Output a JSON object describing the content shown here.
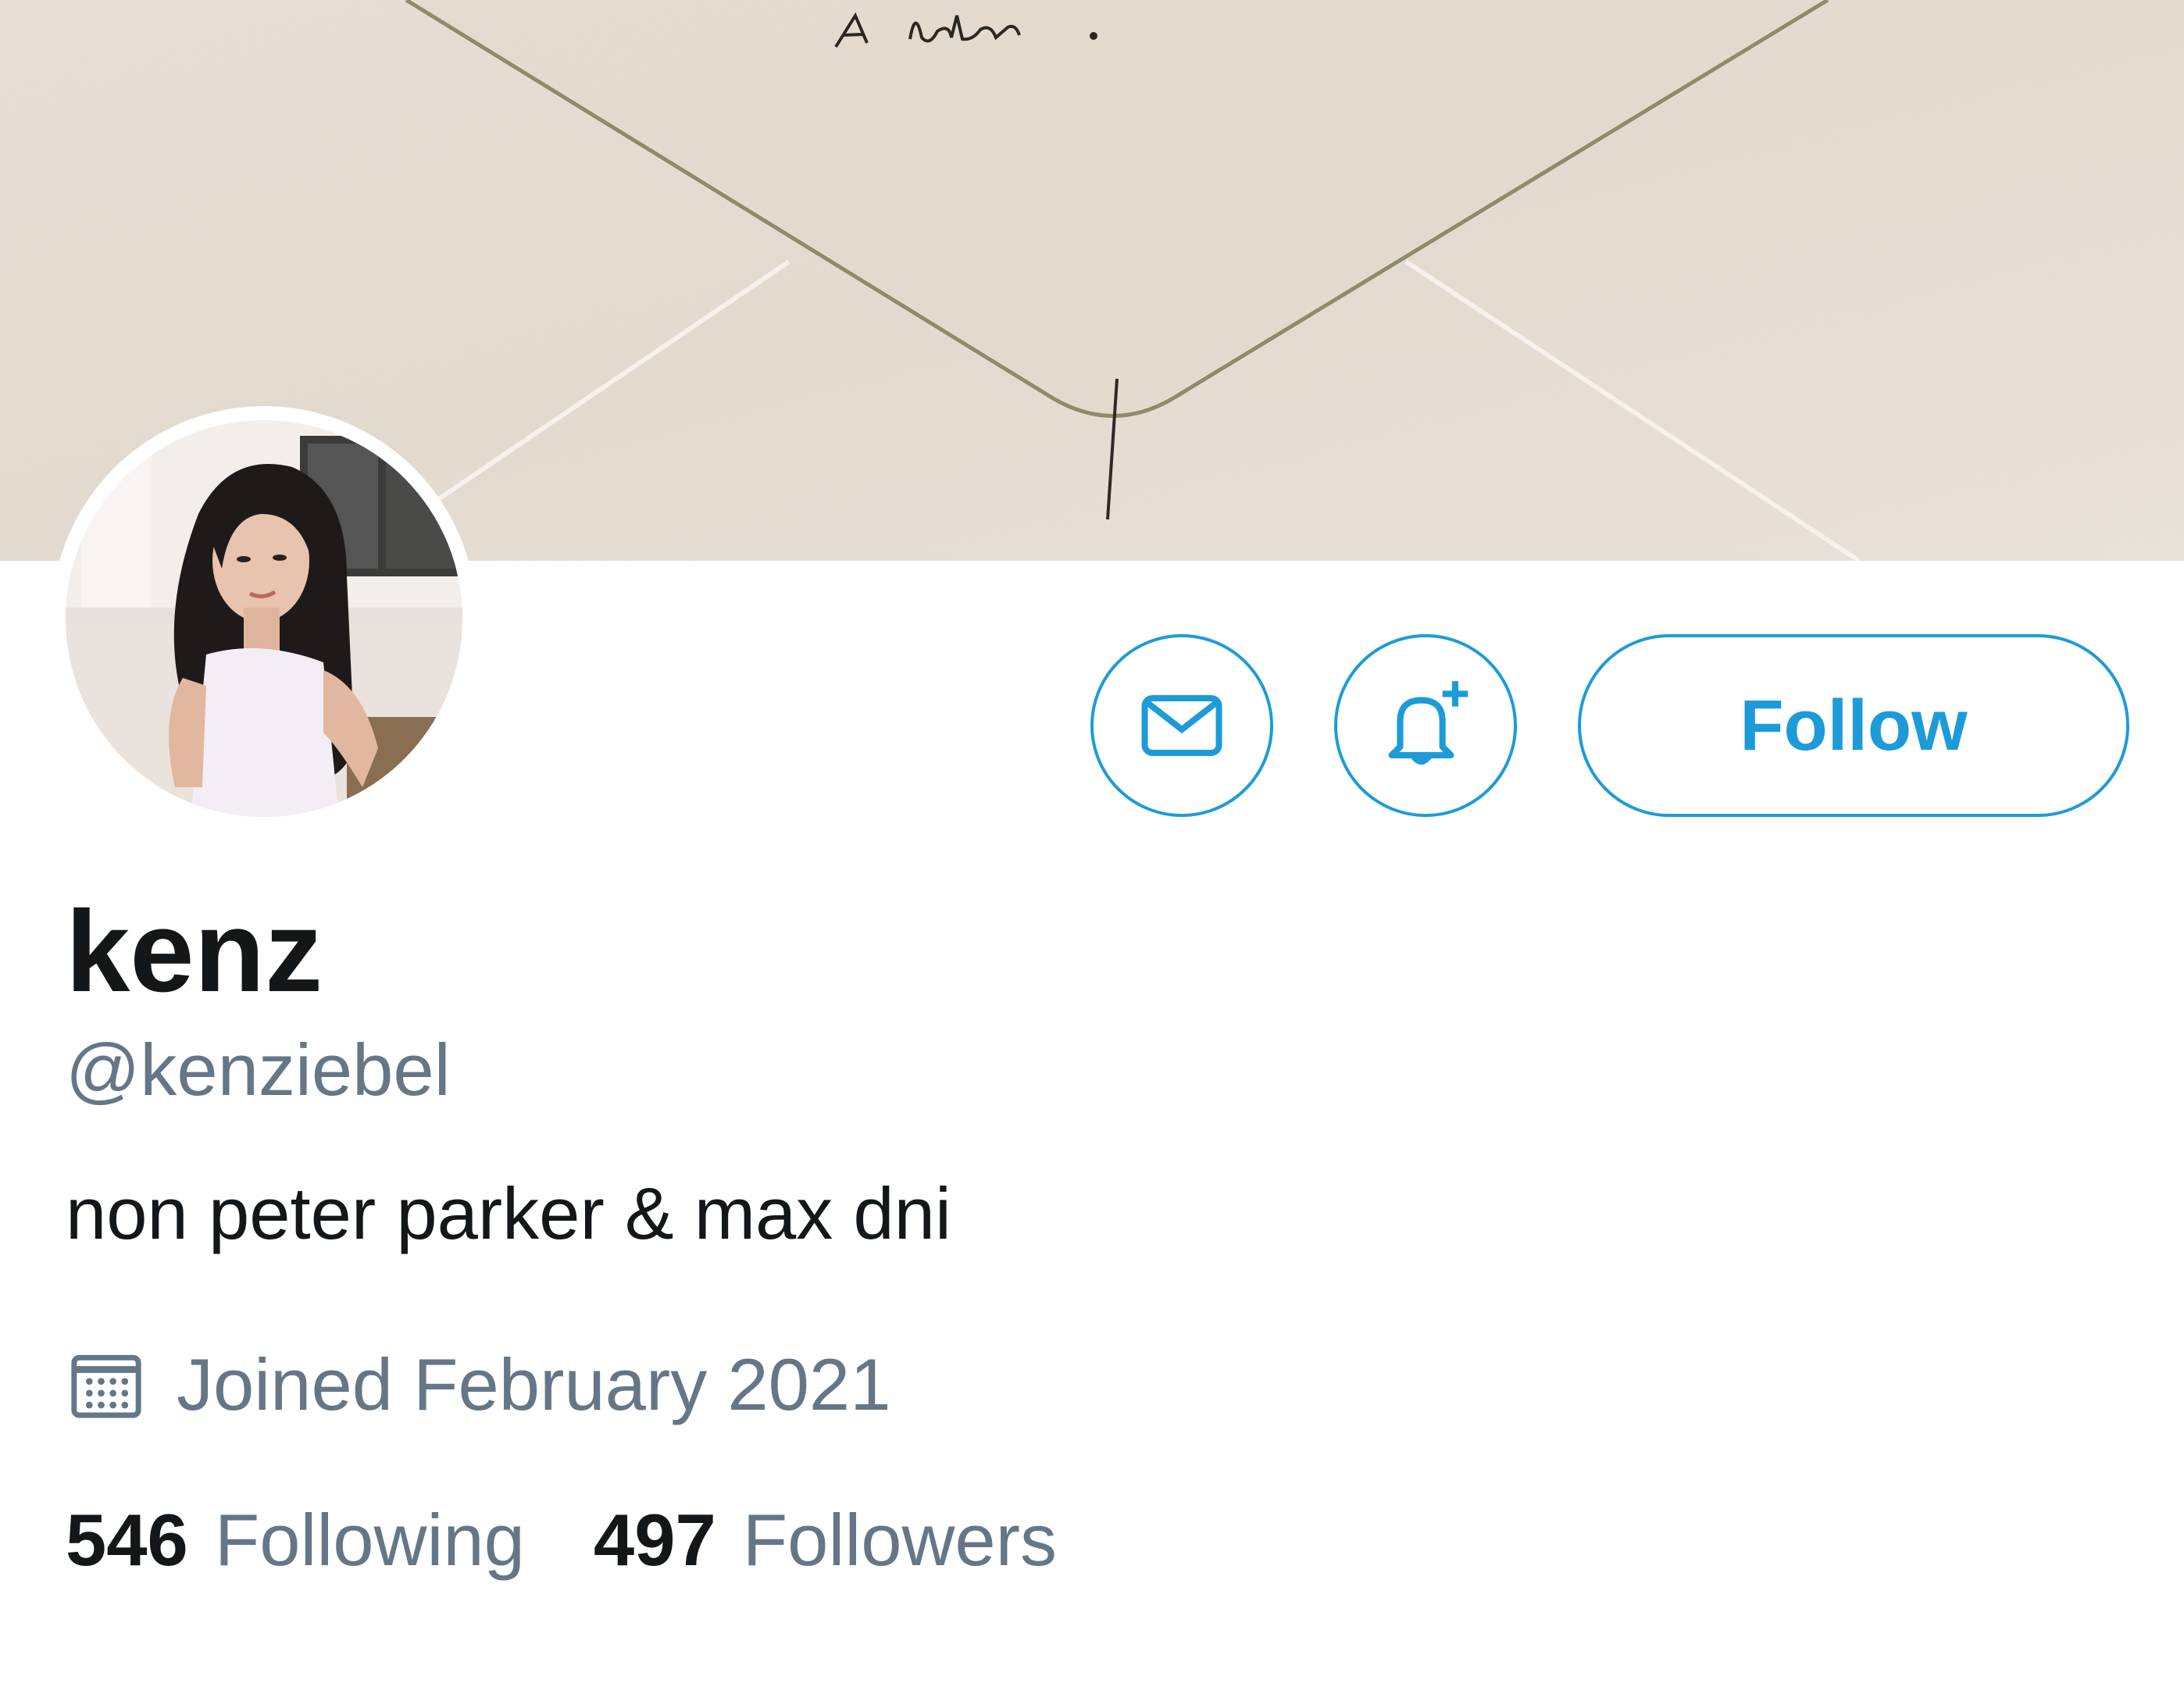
{
  "banner": {
    "handwriting": "A letter."
  },
  "actions": {
    "message_icon": "envelope-icon",
    "notify_icon": "bell-plus-icon",
    "follow_label": "Follow",
    "accent_color": "#1d9bd8"
  },
  "profile": {
    "display_name": "kenz",
    "handle": "@kenziebel",
    "bio": "non peter parker & max dni",
    "joined_icon": "calendar-icon",
    "joined": "Joined February 2021"
  },
  "stats": {
    "following_count": "546",
    "following_label": "Following",
    "followers_count": "497",
    "followers_label": "Followers"
  }
}
